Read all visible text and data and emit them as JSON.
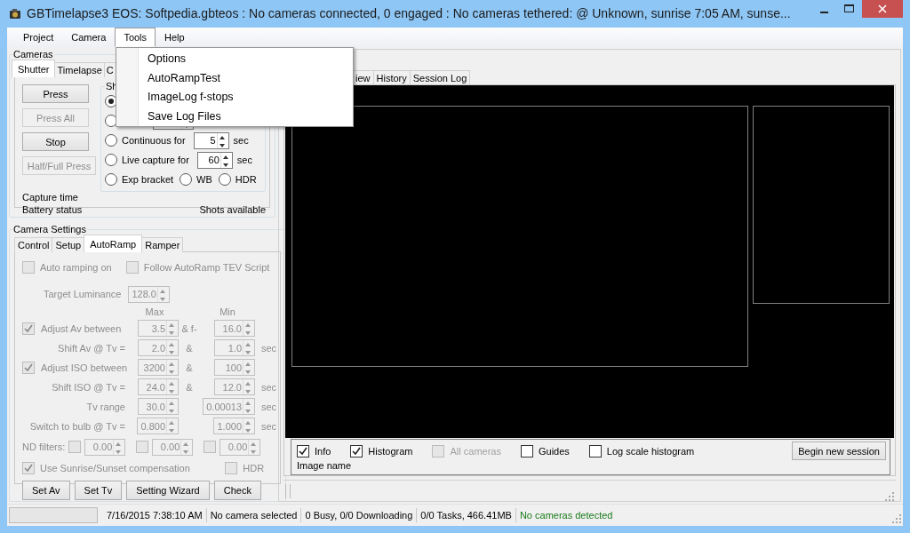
{
  "window": {
    "title": "GBTimelapse3 EOS: Softpedia.gbteos : No cameras connected, 0 engaged : No cameras tethered: @ Unknown, sunrise 7:05 AM, sunse..."
  },
  "menu": [
    {
      "label": "Project",
      "selected": false
    },
    {
      "label": "Camera",
      "selected": false
    },
    {
      "label": "Tools",
      "selected": true
    },
    {
      "label": "Help",
      "selected": false
    }
  ],
  "tools_menu": [
    "Options",
    "AutoRampTest",
    "ImageLog f-stops",
    "Save Log Files"
  ],
  "cameras": {
    "title": "Cameras",
    "tabs": [
      {
        "label": "Shutter",
        "selected": true
      },
      {
        "label": "Timelapse",
        "selected": false
      },
      {
        "label": "C",
        "selected": false
      }
    ],
    "buttons": [
      {
        "label": "Press",
        "disabled": false
      },
      {
        "label": "Press All",
        "disabled": true
      },
      {
        "label": "Stop",
        "disabled": false
      },
      {
        "label": "Half/Full Press",
        "disabled": true
      }
    ],
    "capture_time": "Capture time",
    "battery_status": "Battery status",
    "shots_available": "Shots available",
    "shot_group": {
      "title": "Sh",
      "options": [
        {
          "kind": "plain",
          "selected": true
        },
        {
          "kind": "field",
          "selected": false
        },
        {
          "kind": "timed",
          "label": "Continuous for",
          "value": "5",
          "unit": "sec",
          "selected": false
        },
        {
          "kind": "timed",
          "label": "Live capture for",
          "value": "60",
          "unit": "sec",
          "selected": false
        }
      ],
      "bracket": [
        {
          "label": "Exp bracket",
          "selected": false
        },
        {
          "label": "WB",
          "selected": false
        },
        {
          "label": "HDR",
          "selected": false
        }
      ]
    }
  },
  "camera_settings": {
    "title": "Camera Settings",
    "tabs": [
      {
        "label": "Control",
        "selected": false
      },
      {
        "label": "Setup",
        "selected": false
      },
      {
        "label": "AutoRamp",
        "selected": true
      },
      {
        "label": "Ramper",
        "selected": false
      }
    ],
    "disabled": true,
    "auto_ramping": {
      "label": "Auto ramping on",
      "checked": false
    },
    "follow_script": {
      "label": "Follow AutoRamp TEV Script",
      "checked": false
    },
    "target_luminance": {
      "label": "Target Luminance",
      "value": "128.0"
    },
    "max_heading": "Max",
    "min_heading": "Min",
    "rows": [
      {
        "kind": "check",
        "label": "Adjust Av between",
        "checked": true,
        "max": "3.5",
        "sep": "& f-",
        "min": "16.0"
      },
      {
        "kind": "label",
        "label": "Shift Av @ Tv =",
        "max": "2.0",
        "sep": "&",
        "min": "1.0",
        "unit": "sec"
      },
      {
        "kind": "check",
        "label": "Adjust ISO between",
        "checked": true,
        "max": "3200",
        "sep": "&",
        "min": "100"
      },
      {
        "kind": "label",
        "label": "Shift ISO @ Tv =",
        "max": "24.0",
        "sep": "&",
        "min": "12.0",
        "unit": "sec"
      },
      {
        "kind": "label",
        "label": "Tv range",
        "max": "30.0",
        "min": "0.00013",
        "unit": "sec"
      },
      {
        "kind": "label",
        "label": "Switch to bulb @ Tv =",
        "max": "0.800",
        "min": "1.000",
        "unit": "sec"
      }
    ],
    "nd_filters": {
      "label": "ND filters:",
      "filters": [
        {
          "checked": false,
          "value": "0.00"
        },
        {
          "checked": false,
          "value": "0.00"
        },
        {
          "checked": false,
          "value": "0.00"
        }
      ]
    },
    "sunrise": {
      "label": "Use Sunrise/Sunset compensation",
      "checked": true
    },
    "hdr": {
      "label": "HDR",
      "checked": false
    },
    "buttons": [
      "Set Av",
      "Set Tv",
      "Setting Wizard",
      "Check"
    ]
  },
  "viewer": {
    "tabs": [
      {
        "label": "iew",
        "selected": false
      },
      {
        "label": "History",
        "selected": false
      },
      {
        "label": "Session Log",
        "selected": false
      }
    ],
    "options": [
      {
        "label": "Info",
        "checked": true,
        "disabled": false
      },
      {
        "label": "Histogram",
        "checked": true,
        "disabled": false
      },
      {
        "label": "All cameras",
        "checked": false,
        "disabled": true
      },
      {
        "label": "Guides",
        "checked": false,
        "disabled": false
      },
      {
        "label": "Log scale histogram",
        "checked": false,
        "disabled": false
      }
    ],
    "button": "Begin new session",
    "image_name": "Image name"
  },
  "status_bar": [
    {
      "kind": "progress",
      "level": 0
    },
    {
      "kind": "text",
      "text": "7/16/2015 7:38:10 AM"
    },
    {
      "kind": "text",
      "text": "No camera selected"
    },
    {
      "kind": "text",
      "text": "0 Busy, 0/0 Downloading"
    },
    {
      "kind": "text",
      "text": "0/0 Tasks, 466.41MB"
    },
    {
      "kind": "notice",
      "text": "No cameras detected"
    }
  ]
}
